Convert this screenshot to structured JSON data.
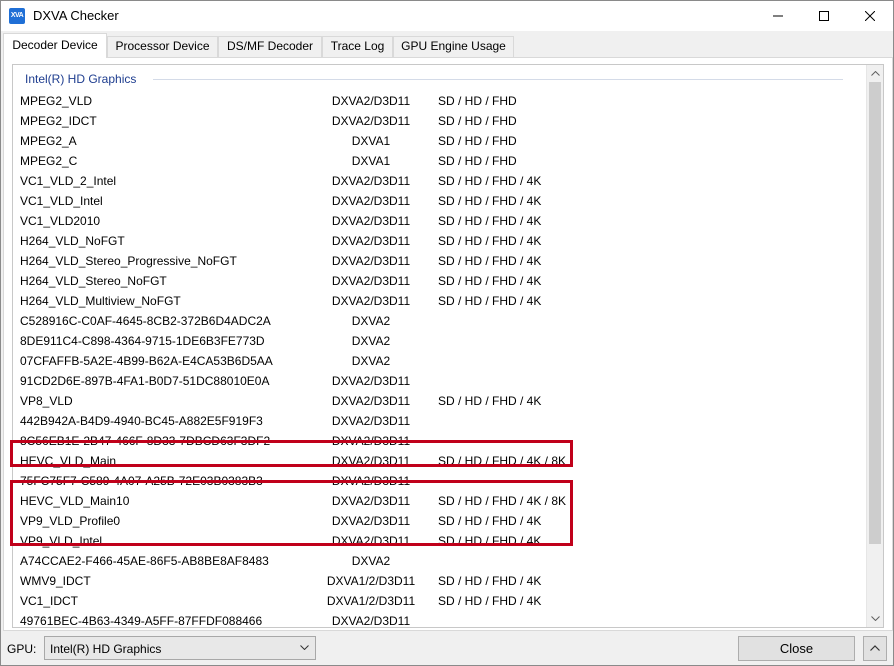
{
  "window": {
    "title": "DXVA Checker",
    "icon_label": "XVA"
  },
  "tabs": [
    "Decoder Device",
    "Processor Device",
    "DS/MF Decoder",
    "Trace Log",
    "GPU Engine Usage"
  ],
  "group": "Intel(R) HD Graphics",
  "rows": [
    {
      "name": "MPEG2_VLD",
      "api": "DXVA2/D3D11",
      "res": "SD / HD / FHD"
    },
    {
      "name": "MPEG2_IDCT",
      "api": "DXVA2/D3D11",
      "res": "SD / HD / FHD"
    },
    {
      "name": "MPEG2_A",
      "api": "DXVA1",
      "res": "SD / HD / FHD"
    },
    {
      "name": "MPEG2_C",
      "api": "DXVA1",
      "res": "SD / HD / FHD"
    },
    {
      "name": "VC1_VLD_2_Intel",
      "api": "DXVA2/D3D11",
      "res": "SD / HD / FHD / 4K"
    },
    {
      "name": "VC1_VLD_Intel",
      "api": "DXVA2/D3D11",
      "res": "SD / HD / FHD / 4K"
    },
    {
      "name": "VC1_VLD2010",
      "api": "DXVA2/D3D11",
      "res": "SD / HD / FHD / 4K"
    },
    {
      "name": "H264_VLD_NoFGT",
      "api": "DXVA2/D3D11",
      "res": "SD / HD / FHD / 4K"
    },
    {
      "name": "H264_VLD_Stereo_Progressive_NoFGT",
      "api": "DXVA2/D3D11",
      "res": "SD / HD / FHD / 4K"
    },
    {
      "name": "H264_VLD_Stereo_NoFGT",
      "api": "DXVA2/D3D11",
      "res": "SD / HD / FHD / 4K"
    },
    {
      "name": "H264_VLD_Multiview_NoFGT",
      "api": "DXVA2/D3D11",
      "res": "SD / HD / FHD / 4K"
    },
    {
      "name": "C528916C-C0AF-4645-8CB2-372B6D4ADC2A",
      "api": "DXVA2",
      "res": ""
    },
    {
      "name": "8DE911C4-C898-4364-9715-1DE6B3FE773D",
      "api": "DXVA2",
      "res": ""
    },
    {
      "name": "07CFAFFB-5A2E-4B99-B62A-E4CA53B6D5AA",
      "api": "DXVA2",
      "res": ""
    },
    {
      "name": "91CD2D6E-897B-4FA1-B0D7-51DC88010E0A",
      "api": "DXVA2/D3D11",
      "res": ""
    },
    {
      "name": "VP8_VLD",
      "api": "DXVA2/D3D11",
      "res": "SD / HD / FHD / 4K"
    },
    {
      "name": "442B942A-B4D9-4940-BC45-A882E5F919F3",
      "api": "DXVA2/D3D11",
      "res": ""
    },
    {
      "name": "8C56EB1E-2B47-466F-8D33-7DBCD63F3DF2",
      "api": "DXVA2/D3D11",
      "res": ""
    },
    {
      "name": "HEVC_VLD_Main",
      "api": "DXVA2/D3D11",
      "res": "SD / HD / FHD / 4K / 8K"
    },
    {
      "name": "75FC75F7-C589-4A07-A25B-72E03B0383B3",
      "api": "DXVA2/D3D11",
      "res": ""
    },
    {
      "name": "HEVC_VLD_Main10",
      "api": "DXVA2/D3D11",
      "res": "SD / HD / FHD / 4K / 8K"
    },
    {
      "name": "VP9_VLD_Profile0",
      "api": "DXVA2/D3D11",
      "res": "SD / HD / FHD / 4K"
    },
    {
      "name": "VP9_VLD_Intel",
      "api": "DXVA2/D3D11",
      "res": "SD / HD / FHD / 4K"
    },
    {
      "name": "A74CCAE2-F466-45AE-86F5-AB8BE8AF8483",
      "api": "DXVA2",
      "res": ""
    },
    {
      "name": "WMV9_IDCT",
      "api": "DXVA1/2/D3D11",
      "res": "SD / HD / FHD / 4K"
    },
    {
      "name": "VC1_IDCT",
      "api": "DXVA1/2/D3D11",
      "res": "SD / HD / FHD / 4K"
    },
    {
      "name": "49761BEC-4B63-4349-A5FF-87FFDF088466",
      "api": "DXVA2/D3D11",
      "res": ""
    }
  ],
  "highlighted_rows": [
    "HEVC_VLD_Main",
    "HEVC_VLD_Main10",
    "VP9_VLD_Profile0",
    "VP9_VLD_Intel"
  ],
  "footer": {
    "gpu_label": "GPU:",
    "gpu_value": "Intel(R) HD Graphics",
    "close_label": "Close"
  },
  "colors": {
    "highlight": "#c0001a",
    "group_header": "#1e3d8f",
    "icon": "#1f6fd6"
  }
}
